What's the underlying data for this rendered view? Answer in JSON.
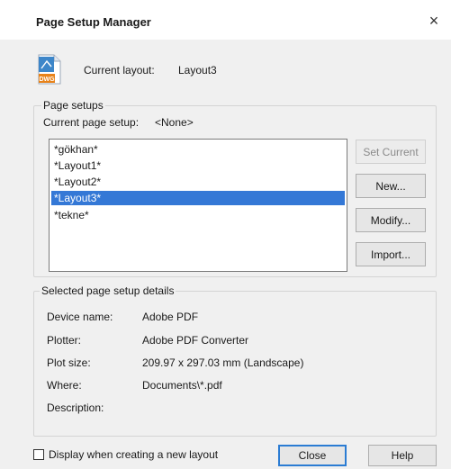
{
  "dialog": {
    "title": "Page Setup Manager",
    "close_glyph": "×"
  },
  "current_layout": {
    "icon": "dwg-file-icon",
    "icon_text": "DWG",
    "label": "Current layout:",
    "value": "Layout3"
  },
  "page_setups": {
    "group_label": "Page setups",
    "current_label": "Current page setup:",
    "current_value": "<None>",
    "items": [
      "*gökhan*",
      "*Layout1*",
      "*Layout2*",
      "*Layout3*",
      "*tekne*"
    ],
    "selected_index": 3,
    "buttons": {
      "set_current": "Set Current",
      "new": "New...",
      "modify": "Modify...",
      "import": "Import..."
    }
  },
  "details": {
    "group_label": "Selected page setup details",
    "device_name_label": "Device name:",
    "device_name_value": "Adobe PDF",
    "plotter_label": "Plotter:",
    "plotter_value": "Adobe PDF Converter",
    "plot_size_label": "Plot size:",
    "plot_size_value": "209.97 x 297.03 mm (Landscape)",
    "where_label": "Where:",
    "where_value": "Documents\\*.pdf",
    "description_label": "Description:"
  },
  "footer": {
    "checkbox_label": "Display when creating a new layout",
    "checkbox_checked": false,
    "close_button": "Close",
    "help_button": "Help"
  },
  "colors": {
    "selection": "#3478d6",
    "dialog_bg": "#f0f0f0",
    "primary_border": "#2b7cd3"
  }
}
